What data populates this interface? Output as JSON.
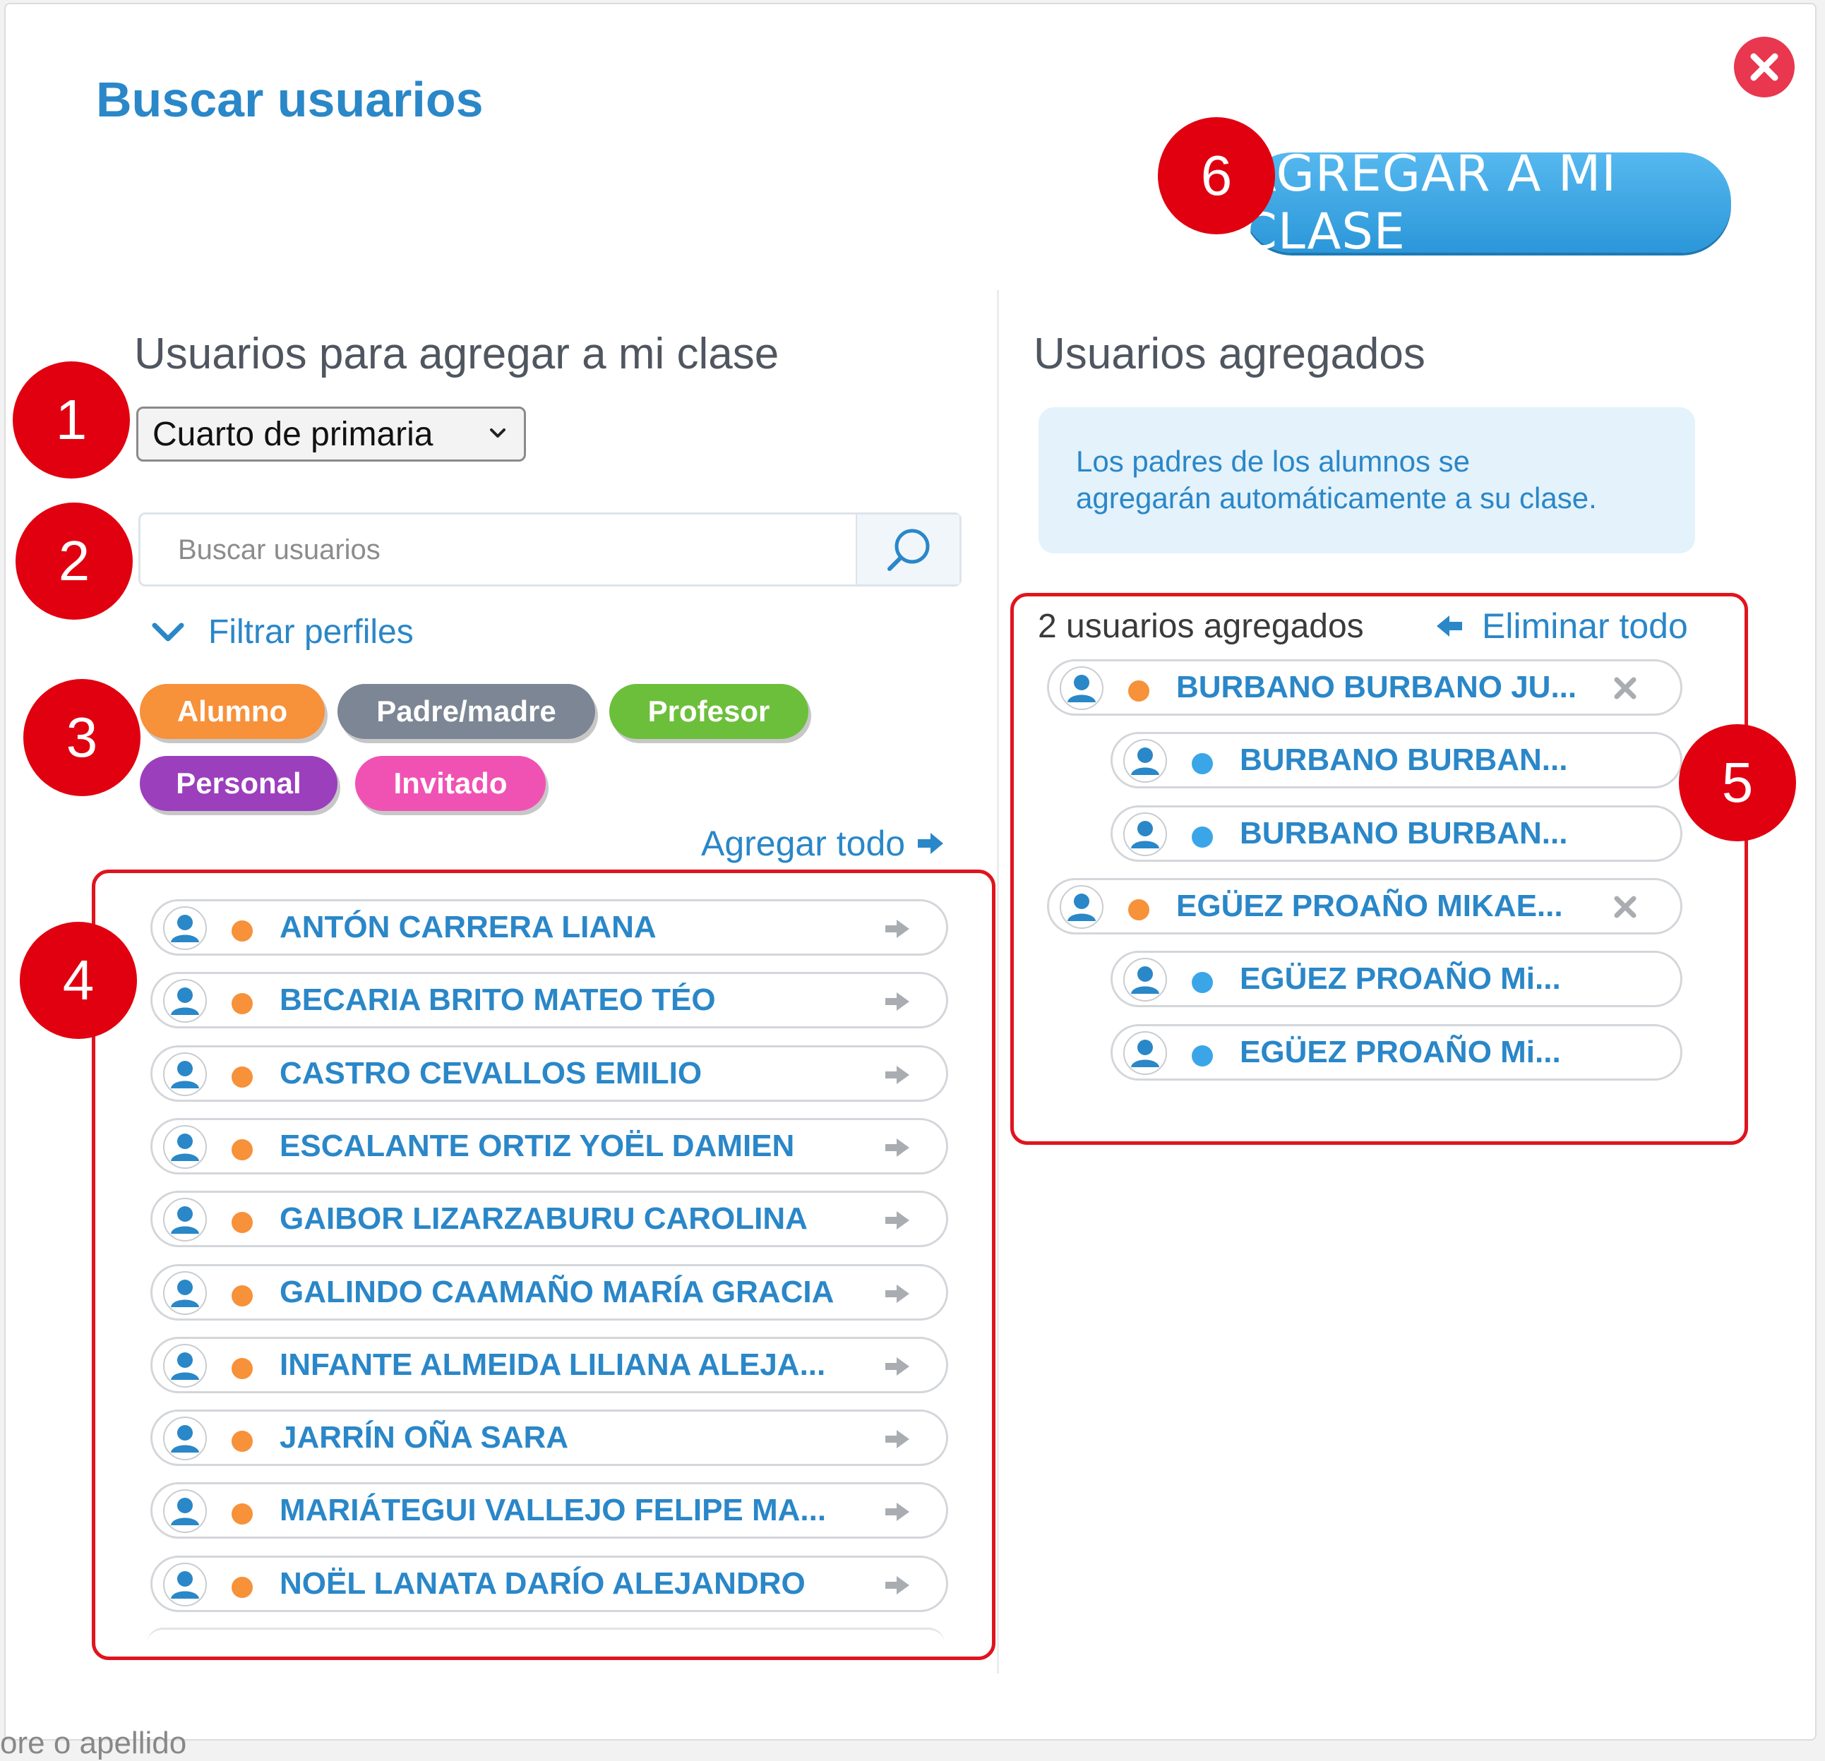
{
  "dialog": {
    "title": "Buscar usuarios",
    "add_button_label": "AGREGAR A MI CLASE",
    "background_hint": "ore o apellido"
  },
  "left": {
    "heading": "Usuarios para agregar a mi clase",
    "grade_select": {
      "selected": "Cuarto de primaria"
    },
    "search": {
      "placeholder": "Buscar usuarios"
    },
    "filter_toggle_label": "Filtrar perfiles",
    "profile_filters": [
      {
        "label": "Alumno",
        "color": "#f7913a"
      },
      {
        "label": "Padre/madre",
        "color": "#7c8694"
      },
      {
        "label": "Profesor",
        "color": "#6cbf3b"
      },
      {
        "label": "Personal",
        "color": "#9b3fbd"
      },
      {
        "label": "Invitado",
        "color": "#f052b4"
      }
    ],
    "add_all_label": "Agregar todo",
    "users": [
      "ANTÓN CARRERA LIANA",
      "BECARIA BRITO MATEO TÉO",
      "CASTRO CEVALLOS EMILIO",
      "ESCALANTE ORTIZ YOËL DAMIEN",
      "GAIBOR LIZARZABURU CAROLINA",
      "GALINDO CAAMAÑO MARÍA GRACIA",
      "INFANTE ALMEIDA LILIANA ALEJA...",
      "JARRÍN OÑA SARA",
      "MARIÁTEGUI VALLEJO FELIPE MA...",
      "NOËL LANATA DARÍO ALEJANDRO"
    ]
  },
  "right": {
    "heading": "Usuarios agregados",
    "info_line1": "Los padres de los alumnos se",
    "info_line2": "agregarán automáticamente a su clase.",
    "count_label": "2 usuarios agregados",
    "remove_all_label": "Eliminar todo",
    "added": [
      {
        "name": "BURBANO BURBANO JU...",
        "role": "student"
      },
      {
        "name": "BURBANO BURBAN...",
        "role": "parent"
      },
      {
        "name": "BURBANO BURBAN...",
        "role": "parent"
      },
      {
        "name": "EGÜEZ PROAÑO MIKAE...",
        "role": "student"
      },
      {
        "name": "EGÜEZ PROAÑO Mi...",
        "role": "parent"
      },
      {
        "name": "EGÜEZ PROAÑO Mi...",
        "role": "parent"
      }
    ]
  },
  "annotations": [
    "1",
    "2",
    "3",
    "4",
    "5",
    "6"
  ],
  "colors": {
    "accent": "#2a87c8",
    "student_dot": "#f7913a",
    "parent_dot": "#3aa6e8",
    "annotation_red": "#e0000f"
  }
}
